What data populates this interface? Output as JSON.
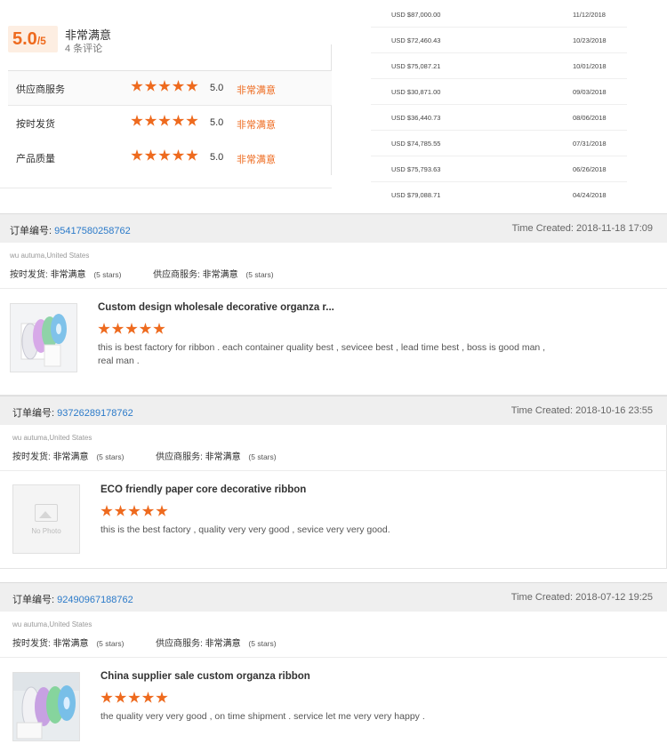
{
  "summary": {
    "score": "5.0",
    "score_den": "/5",
    "overall_label": "非常满意",
    "review_count": "4 条评论",
    "ratings": [
      {
        "label": "供应商服务",
        "stars": 5,
        "value": "5.0",
        "text": "非常满意"
      },
      {
        "label": "按时发货",
        "stars": 5,
        "value": "5.0",
        "text": "非常满意"
      },
      {
        "label": "产品质量",
        "stars": 5,
        "value": "5.0",
        "text": "非常满意"
      }
    ]
  },
  "transactions": [
    {
      "amount": "USD $87,000.00",
      "date": "11/12/2018"
    },
    {
      "amount": "USD $72,460.43",
      "date": "10/23/2018"
    },
    {
      "amount": "USD $75,087.21",
      "date": "10/01/2018"
    },
    {
      "amount": "USD $30,871.00",
      "date": "09/03/2018"
    },
    {
      "amount": "USD $36,440.73",
      "date": "08/06/2018"
    },
    {
      "amount": "USD $74,785.55",
      "date": "07/31/2018"
    },
    {
      "amount": "USD $75,793.63",
      "date": "06/26/2018"
    },
    {
      "amount": "USD $79,088.71",
      "date": "04/24/2018"
    }
  ],
  "orders": [
    {
      "order_no_label": "订单编号:",
      "order_no": "95417580258762",
      "created": "Time Created: 2018-11-18 17:09",
      "buyer": "wu autuma,United States",
      "delivery_label": "按时发货:",
      "delivery_value": "非常满意",
      "delivery_stars": "(5 stars)",
      "service_label": "供应商服务:",
      "service_value": "非常满意",
      "service_stars": "(5 stars)",
      "product_title": "Custom design wholesale decorative organza r...",
      "stars": 5,
      "comment": "this is best factory for ribbon . each container quality best , sevicee best , lead time best , boss is good man , real man .",
      "thumbnail": "ribbon-rolls"
    },
    {
      "order_no_label": "订单编号:",
      "order_no": "93726289178762",
      "created": "Time Created: 2018-10-16 23:55",
      "buyer": "wu autuma,United States",
      "delivery_label": "按时发货:",
      "delivery_value": "非常满意",
      "delivery_stars": "(5 stars)",
      "service_label": "供应商服务:",
      "service_value": "非常满意",
      "service_stars": "(5 stars)",
      "product_title": "ECO friendly paper core decorative ribbon",
      "stars": 5,
      "comment": "this is the best factory , quality very very good , sevice very very good.",
      "thumbnail": "no-photo",
      "no_photo_text": "No Photo"
    },
    {
      "order_no_label": "订单编号:",
      "order_no": "92490967188762",
      "created": "Time Created: 2018-07-12 19:25",
      "buyer": "wu autuma,United States",
      "delivery_label": "按时发货:",
      "delivery_value": "非常满意",
      "delivery_stars": "(5 stars)",
      "service_label": "供应商服务:",
      "service_value": "非常满意",
      "service_stars": "(5 stars)",
      "product_title": "China supplier sale custom organza ribbon",
      "stars": 5,
      "comment": "the quality very very good , on time shipment . service let me very very happy .",
      "thumbnail": "ribbon-rolls"
    }
  ],
  "colors": {
    "accent": "#ee6a1e",
    "link": "#2b7ac9",
    "header_bg": "#efefef"
  }
}
